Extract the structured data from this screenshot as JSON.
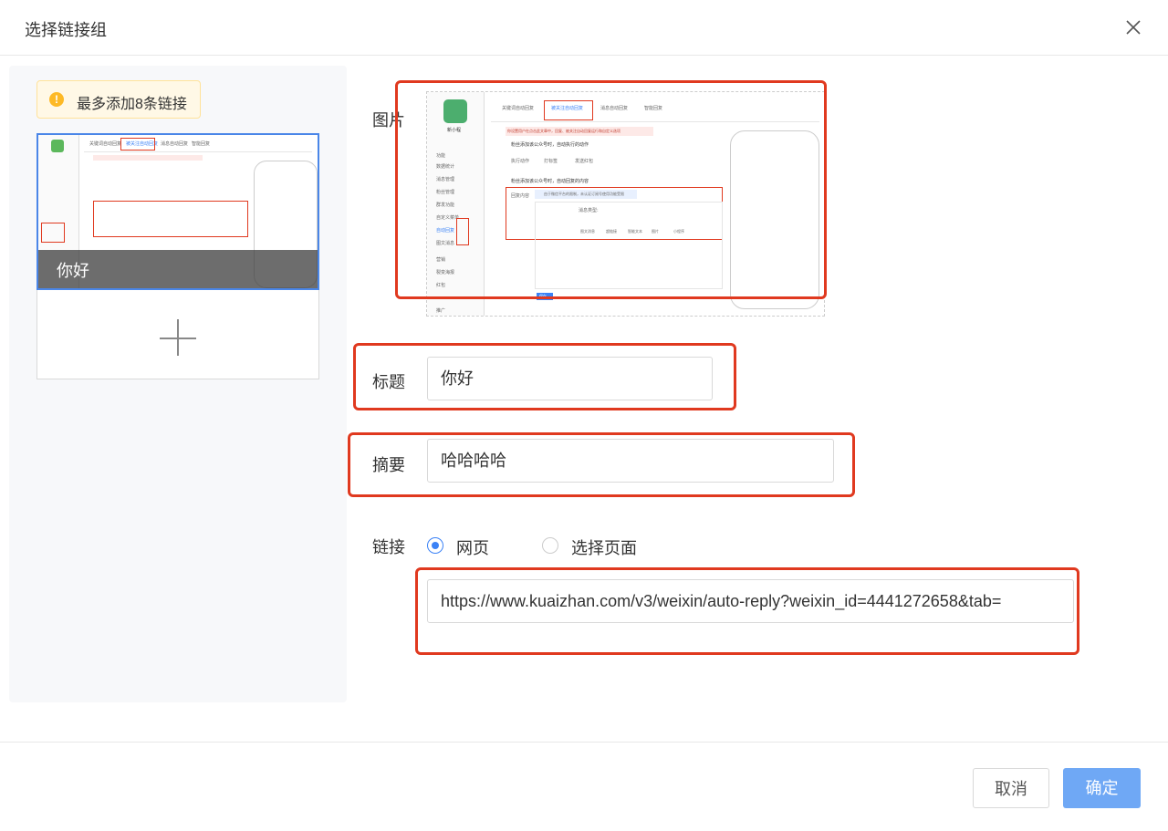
{
  "dialog": {
    "title": "选择链接组"
  },
  "notice": {
    "icon": "!",
    "text": "最多添加8条链接"
  },
  "card": {
    "caption": "你好"
  },
  "form": {
    "image_label": "图片",
    "title_label": "标题",
    "title_value": "你好",
    "summary_label": "摘要",
    "summary_value": "哈哈哈哈",
    "link_label": "链接",
    "link_options": [
      {
        "label": "网页",
        "selected": true
      },
      {
        "label": "选择页面",
        "selected": false
      }
    ],
    "link_value": "https://www.kuaizhan.com/v3/weixin/auto-reply?weixin_id=4441272658&tab="
  },
  "footer": {
    "cancel_label": "取消",
    "confirm_label": "确定"
  },
  "preview": {
    "app_name": "新小程",
    "tabs": [
      "关键词自动回复",
      "被关注自动回复",
      "消息自动回复",
      "智能回复"
    ],
    "notice_text": "你设置用户在点击此文章中，回复、被关注自动回复运行和自定义选项",
    "row1": "粉丝添加该公众号时，自动执行的动作",
    "row1_label": "执行动作",
    "row1_opts": [
      "打标签",
      "发送红包"
    ],
    "row2": "粉丝添加该公众号时，自动回复的内容",
    "reply_label": "回复内容",
    "reply_hint": "由于微信平台的限制，未认证订阅号使用功能受限",
    "msg_type": "消息类型:",
    "msg_icons": [
      "图文消息",
      "超链接",
      "智能文本",
      "图片",
      "小程序"
    ],
    "side_items": [
      "功能",
      "数据统计",
      "消息管理",
      "粉丝管理",
      "群发功能",
      "自定义菜单",
      "自动回复",
      "图文消息",
      "营销",
      "裂变海报",
      "红包",
      "推广"
    ],
    "btn_save": "保存"
  },
  "colors": {
    "accent": "#3b82f6",
    "annotation": "#e0391f",
    "confirm": "#6fa8f5"
  }
}
